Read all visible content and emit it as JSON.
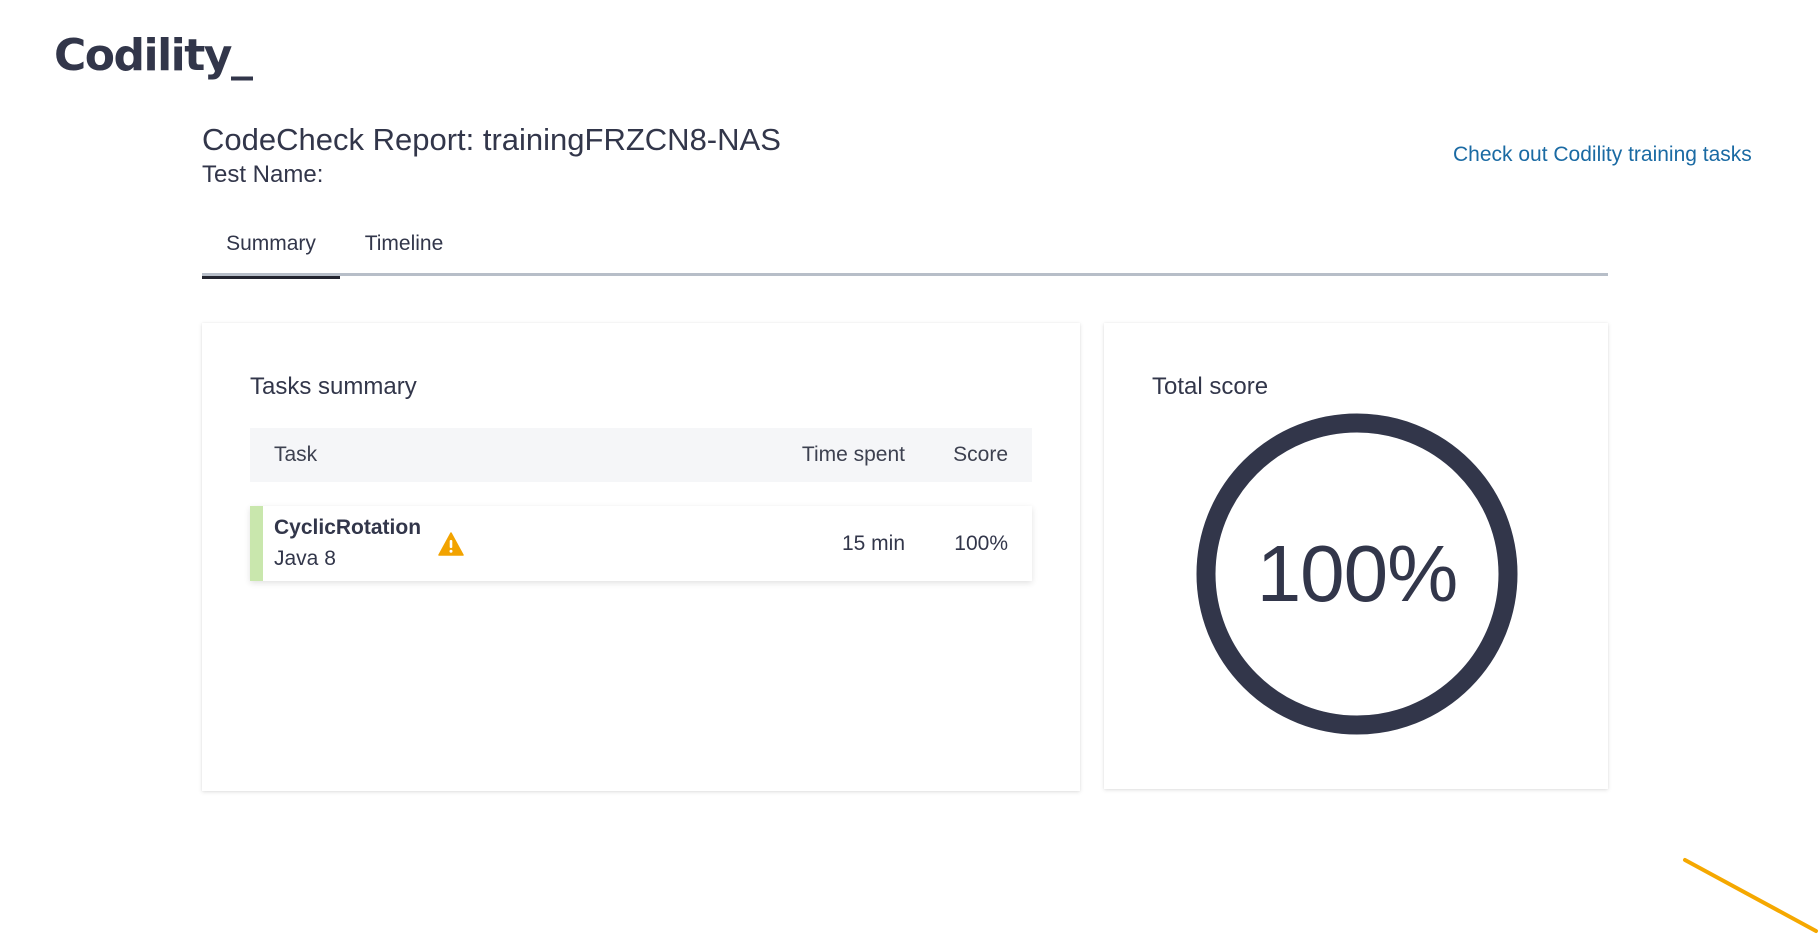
{
  "brand": {
    "logo_text": "Codility_"
  },
  "header": {
    "report_title": "CodeCheck Report: trainingFRZCN8-NAS",
    "test_name_label": "Test Name:"
  },
  "links": {
    "training_tasks": "Check out Codility training tasks"
  },
  "tabs": [
    {
      "label": "Summary",
      "active": true
    },
    {
      "label": "Timeline",
      "active": false
    }
  ],
  "tasks_summary": {
    "title": "Tasks summary",
    "columns": {
      "task": "Task",
      "time_spent": "Time spent",
      "score": "Score"
    },
    "rows": [
      {
        "name": "CyclicRotation",
        "language": "Java 8",
        "time_spent": "15 min",
        "score": "100%",
        "icon": "warning-icon",
        "status_color": "#c9e7ad"
      }
    ]
  },
  "total_score": {
    "title": "Total score",
    "value": "100%",
    "ring_fraction": 1.0
  },
  "colors": {
    "text_dark": "#32364a",
    "link": "#1a6aa3",
    "warning": "#f2a300",
    "accent_line": "#f5a800"
  }
}
